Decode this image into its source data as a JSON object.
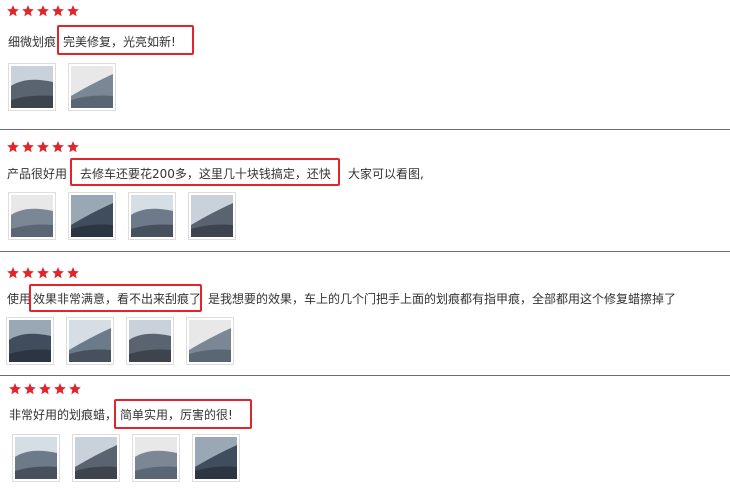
{
  "rating_symbol": "★",
  "colors": {
    "star": "#e0262c",
    "highlight_border": "#e0262c",
    "divider": "#6e6e6e"
  },
  "reviews": [
    {
      "stars": 5,
      "text_before": "细微划痕",
      "highlight": "完美修复，光亮如新!",
      "text_after": "",
      "images": [
        "car-door-photo",
        "scratch-wax-tube-photo"
      ]
    },
    {
      "stars": 5,
      "text_before": "产品很好用",
      "highlight": "去修车还要花200多，这里几十块钱搞定，还快",
      "text_after": "大家可以看图,",
      "images": [
        "headlight-before-photo",
        "headlight-after-photo",
        "car-body-dark-photo",
        "car-panel-blue-photo"
      ]
    },
    {
      "stars": 5,
      "text_before": "使用",
      "highlight": "效果非常满意，看不出来刮痕了",
      "text_after": "是我想要的效果，车上的几个门把手上面的划痕都有指甲痕，全部都用这个修复蜡擦掉了",
      "images": [
        "door-handle-photo-1",
        "door-handle-photo-2",
        "door-handle-photo-3",
        "door-handle-photo-4"
      ]
    },
    {
      "stars": 5,
      "text_before": "非常好用的划痕蜡，",
      "highlight": "简单实用，厉害的很!",
      "text_after": "",
      "images": [
        "car-side-photo-1",
        "car-side-photo-2",
        "car-side-photo-3",
        "car-side-photo-4"
      ]
    }
  ]
}
